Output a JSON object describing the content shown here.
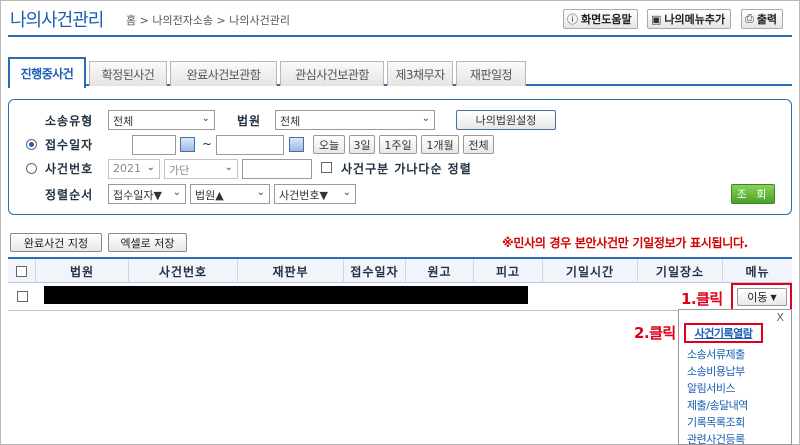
{
  "header": {
    "title": "나의사건관리",
    "breadcrumb": "홈 > 나의전자소송 > 나의사건관리",
    "buttons": {
      "help": "화면도움말",
      "add_menu": "나의메뉴추가",
      "print": "출력"
    }
  },
  "tabs": [
    {
      "label": "진행중사건",
      "active": true
    },
    {
      "label": "확정된사건",
      "active": false
    },
    {
      "label": "완료사건보관함",
      "active": false
    },
    {
      "label": "관심사건보관함",
      "active": false
    },
    {
      "label": "제3채무자",
      "active": false
    },
    {
      "label": "재판일정",
      "active": false
    }
  ],
  "search": {
    "case_type_label": "소송유형",
    "case_type_value": "전체",
    "court_label": "법원",
    "court_value": "전체",
    "my_court_button": "나의법원설정",
    "receipt_date_label": "접수일자",
    "date_separator": "~",
    "period_buttons": [
      "오늘",
      "3일",
      "1주일",
      "1개월",
      "전체"
    ],
    "case_number_label": "사건번호",
    "year_value": "2021",
    "case_kind_value": "가단",
    "sort_checkbox_label": "사건구분 가나다순 정렬",
    "sort_label": "정렬순서",
    "sort_options": [
      "접수일자▼",
      "법원▲",
      "사건번호▼"
    ],
    "search_button": "조 회"
  },
  "actions": {
    "complete_button": "완료사건 지정",
    "excel_button": "엑셀로 저장",
    "notice": "※민사의 경우 본안사건만 기일정보가 표시됩니다."
  },
  "table": {
    "headers": [
      "법원",
      "사건번호",
      "재판부",
      "접수일자",
      "원고",
      "피고",
      "기일시간",
      "기일장소",
      "메뉴"
    ]
  },
  "row_menu": {
    "move_button": "이동",
    "close": "X",
    "items": [
      "사건기록열람",
      "소송서류제출",
      "소송비용납부",
      "알림서비스",
      "제출/송달내역",
      "기록목록조회",
      "관련사건등록"
    ]
  },
  "annotations": {
    "step1": "1.클릭",
    "step2": "2.클릭"
  },
  "colors": {
    "accent": "#1f6fbf",
    "highlight": "#e1001a",
    "search_button": "#4aa126"
  }
}
